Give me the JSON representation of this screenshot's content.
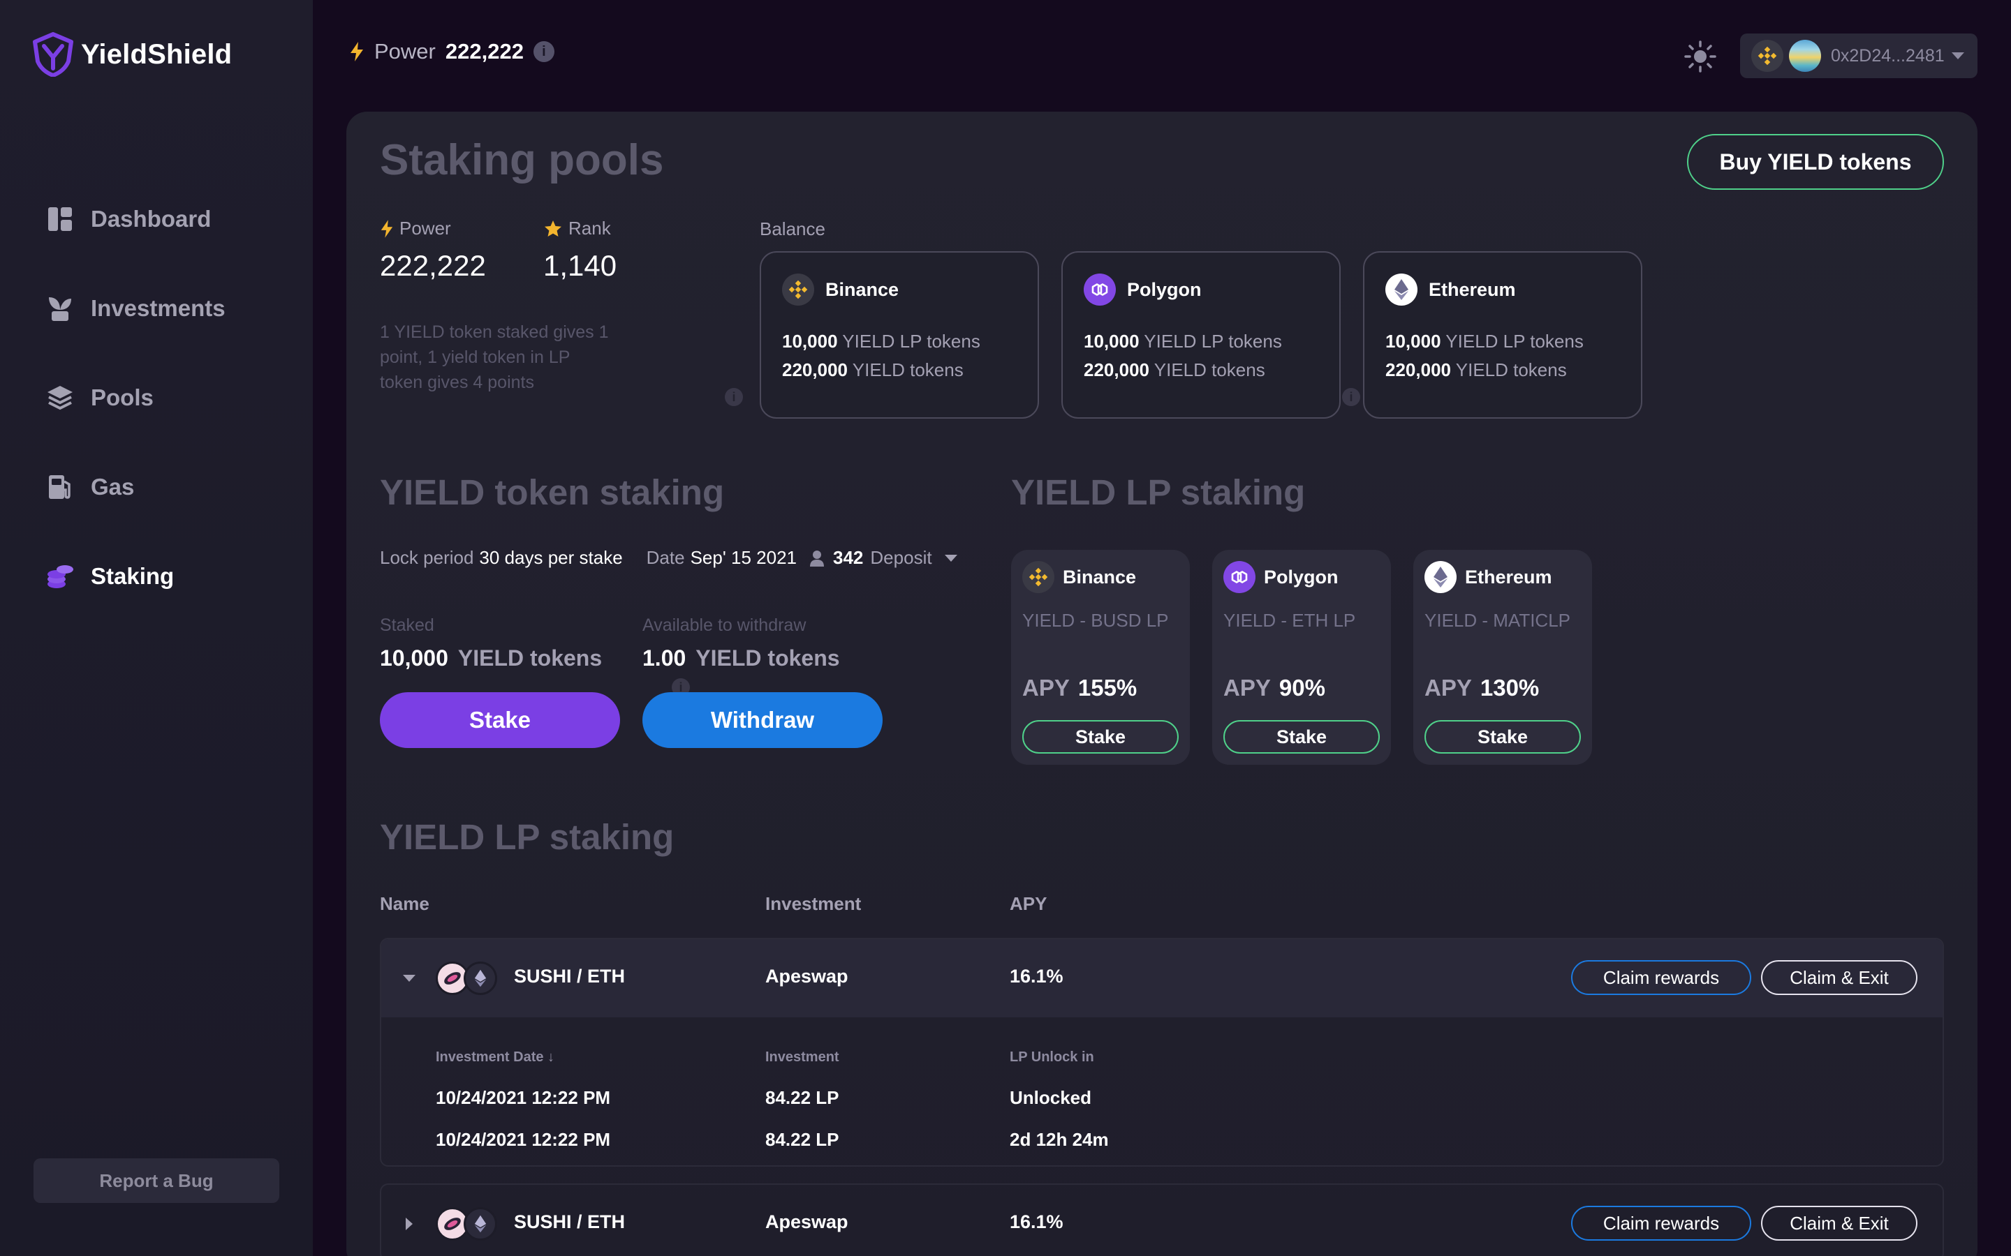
{
  "brand": {
    "name": "YieldShield"
  },
  "sidebar": {
    "items": [
      {
        "label": "Dashboard",
        "icon": "dashboard-icon"
      },
      {
        "label": "Investments",
        "icon": "sprout-icon"
      },
      {
        "label": "Pools",
        "icon": "layers-icon"
      },
      {
        "label": "Gas",
        "icon": "gas-pump-icon"
      },
      {
        "label": "Staking",
        "icon": "coins-icon",
        "active": true
      }
    ],
    "report_bug": "Report a Bug"
  },
  "topbar": {
    "power_label": "Power",
    "power_value": "222,222",
    "wallet_address": "0x2D24...2481"
  },
  "colors": {
    "accent_purple": "#7b3fe4",
    "accent_blue": "#1b7ae0",
    "accent_green": "#4fd18a",
    "power_yellow": "#f3b52e"
  },
  "pools": {
    "title": "Staking pools",
    "buy_button": "Buy YIELD tokens",
    "power_label": "Power",
    "power_value": "222,222",
    "rank_label": "Rank",
    "rank_value": "1,140",
    "points_note": "1 YIELD token staked gives 1 point, 1 yield token in LP token gives 4 points",
    "balance_label": "Balance",
    "balances": [
      {
        "chain": "Binance",
        "lp_amount": "10,000",
        "lp_unit": "YIELD LP tokens",
        "token_amount": "220,000",
        "token_unit": "YIELD tokens"
      },
      {
        "chain": "Polygon",
        "lp_amount": "10,000",
        "lp_unit": "YIELD LP tokens",
        "token_amount": "220,000",
        "token_unit": "YIELD tokens"
      },
      {
        "chain": "Ethereum",
        "lp_amount": "10,000",
        "lp_unit": "YIELD LP tokens",
        "token_amount": "220,000",
        "token_unit": "YIELD tokens"
      }
    ]
  },
  "token_staking": {
    "title": "YIELD token staking",
    "lock_label": "Lock period",
    "lock_value": "30 days per stake",
    "date_label": "Date",
    "date_value": "Sep' 15 2021",
    "deposit_count": "342",
    "deposit_label": "Deposit",
    "staked_label": "Staked",
    "staked_amount": "10,000",
    "staked_unit": "YIELD tokens",
    "available_label": "Available to withdraw",
    "available_amount": "1.00",
    "available_unit": "YIELD tokens",
    "stake_button": "Stake",
    "withdraw_button": "Withdraw"
  },
  "lp_staking": {
    "title": "YIELD LP staking",
    "cards": [
      {
        "chain": "Binance",
        "pair": "YIELD - BUSD LP",
        "apy_label": "APY",
        "apy": "155%",
        "button": "Stake"
      },
      {
        "chain": "Polygon",
        "pair": "YIELD - ETH LP",
        "apy_label": "APY",
        "apy": "90%",
        "button": "Stake"
      },
      {
        "chain": "Ethereum",
        "pair": "YIELD - MATICLP",
        "apy_label": "APY",
        "apy": "130%",
        "button": "Stake"
      }
    ]
  },
  "lp_table": {
    "title": "YIELD LP staking",
    "headers": {
      "name": "Name",
      "investment": "Investment",
      "apy": "APY"
    },
    "rows": [
      {
        "name": "SUSHI / ETH",
        "investment": "Apeswap",
        "apy": "16.1%",
        "claim": "Claim rewards",
        "exit": "Claim & Exit",
        "expanded": true,
        "sub_headers": {
          "date": "Investment Date ↓",
          "investment": "Investment",
          "unlock": "LP Unlock in"
        },
        "sub_rows": [
          {
            "date": "10/24/2021 12:22 PM",
            "investment": "84.22 LP",
            "unlock": "Unlocked"
          },
          {
            "date": "10/24/2021 12:22 PM",
            "investment": "84.22 LP",
            "unlock": "2d 12h 24m"
          }
        ]
      },
      {
        "name": "SUSHI / ETH",
        "investment": "Apeswap",
        "apy": "16.1%",
        "claim": "Claim rewards",
        "exit": "Claim & Exit",
        "expanded": false
      }
    ]
  }
}
